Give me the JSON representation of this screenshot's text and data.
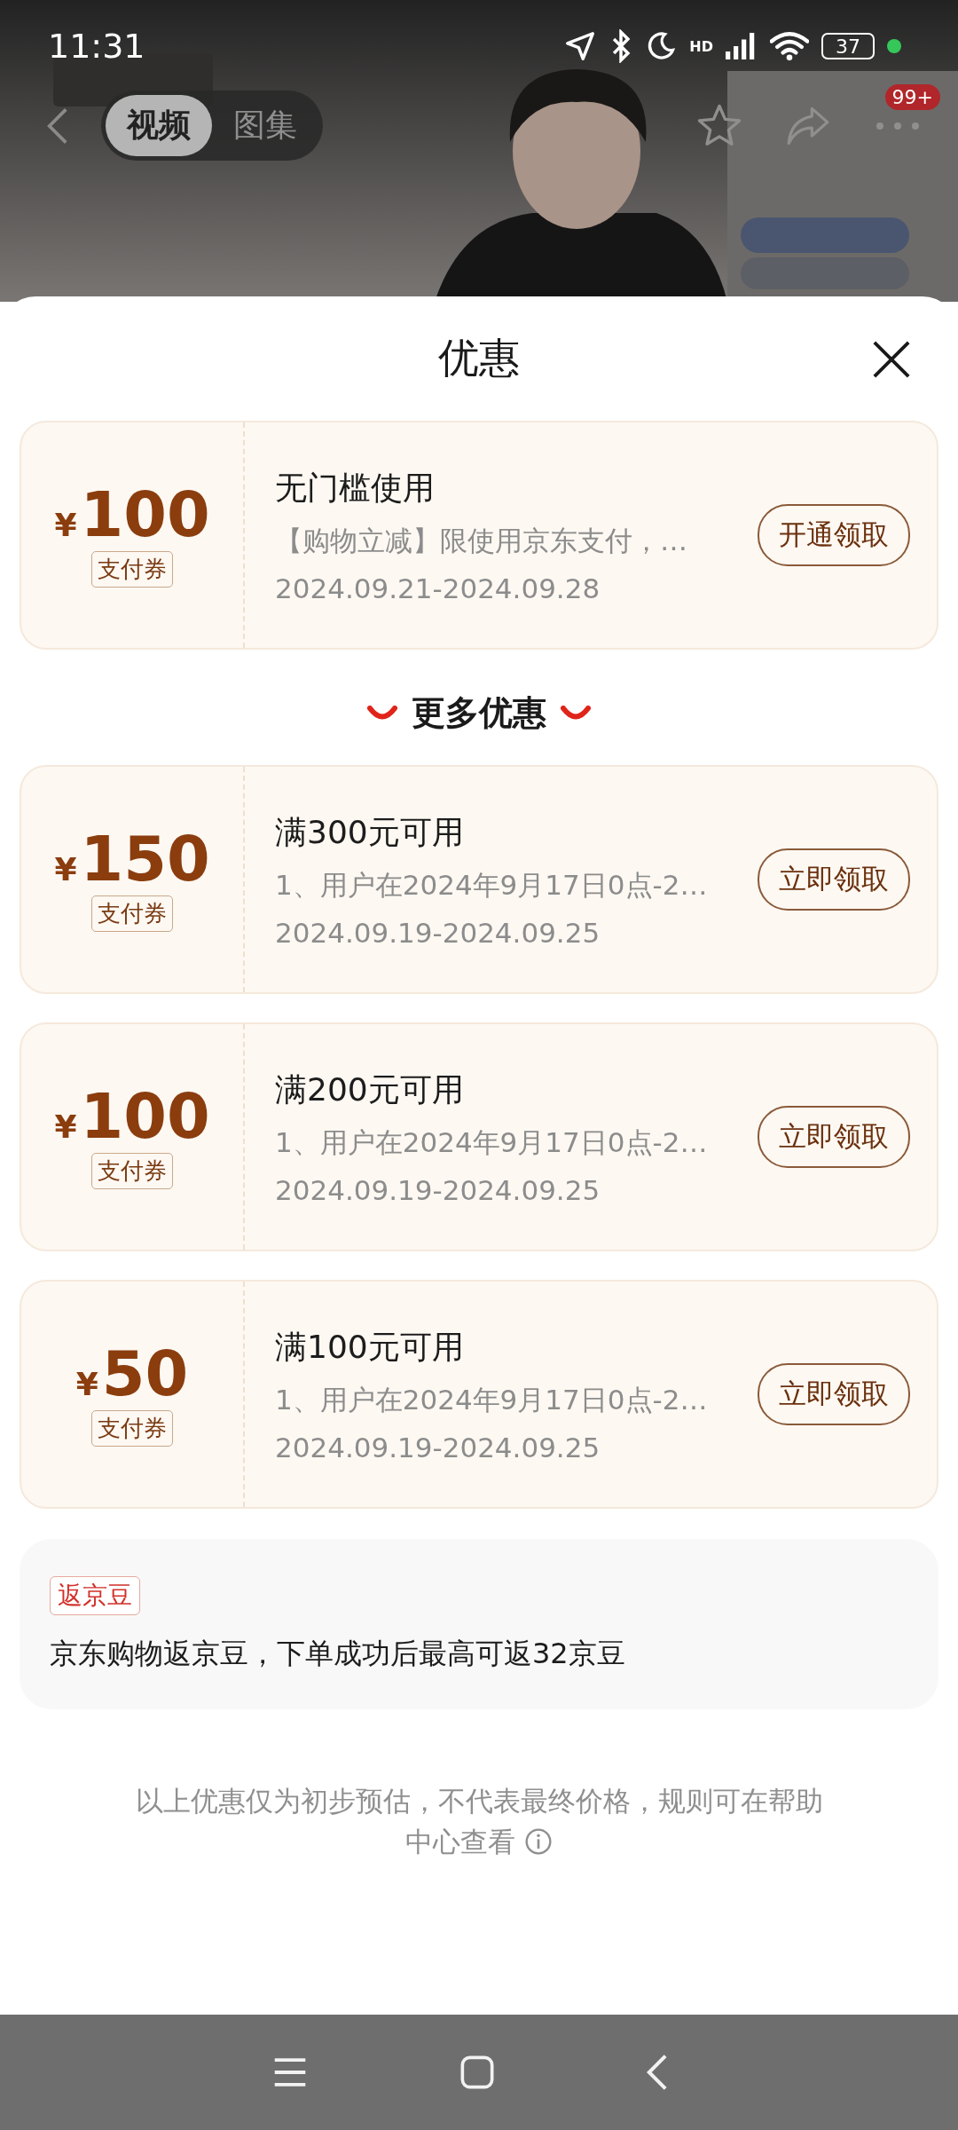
{
  "status_bar": {
    "time": "11:31",
    "network_label": "HD",
    "battery": "37"
  },
  "media_tabs": [
    {
      "label": "视频",
      "selected": true
    },
    {
      "label": "图集",
      "selected": false
    }
  ],
  "cart_badge": "99+",
  "sheet": {
    "title": "优惠"
  },
  "coupons": [
    {
      "currency": "¥",
      "amount": "100",
      "type_tag": "支付券",
      "title": "无门槛使用",
      "description": "【购物立减】限使用京东支付，…",
      "validity": "2024.09.21-2024.09.28",
      "action": "开通领取"
    }
  ],
  "more_header": "更多优惠",
  "more_coupons": [
    {
      "currency": "¥",
      "amount": "150",
      "type_tag": "支付券",
      "title": "满300元可用",
      "description": "1、用户在2024年9月17日0点-2…",
      "validity": "2024.09.19-2024.09.25",
      "action": "立即领取"
    },
    {
      "currency": "¥",
      "amount": "100",
      "type_tag": "支付券",
      "title": "满200元可用",
      "description": "1、用户在2024年9月17日0点-2…",
      "validity": "2024.09.19-2024.09.25",
      "action": "立即领取"
    },
    {
      "currency": "¥",
      "amount": "50",
      "type_tag": "支付券",
      "title": "满100元可用",
      "description": "1、用户在2024年9月17日0点-2…",
      "validity": "2024.09.19-2024.09.25",
      "action": "立即领取"
    }
  ],
  "bean": {
    "tag": "返京豆",
    "text": "京东购物返京豆，下单成功后最高可返32京豆"
  },
  "footer_note": "以上优惠仅为初步预估，不代表最终价格，规则可在帮助中心查看"
}
